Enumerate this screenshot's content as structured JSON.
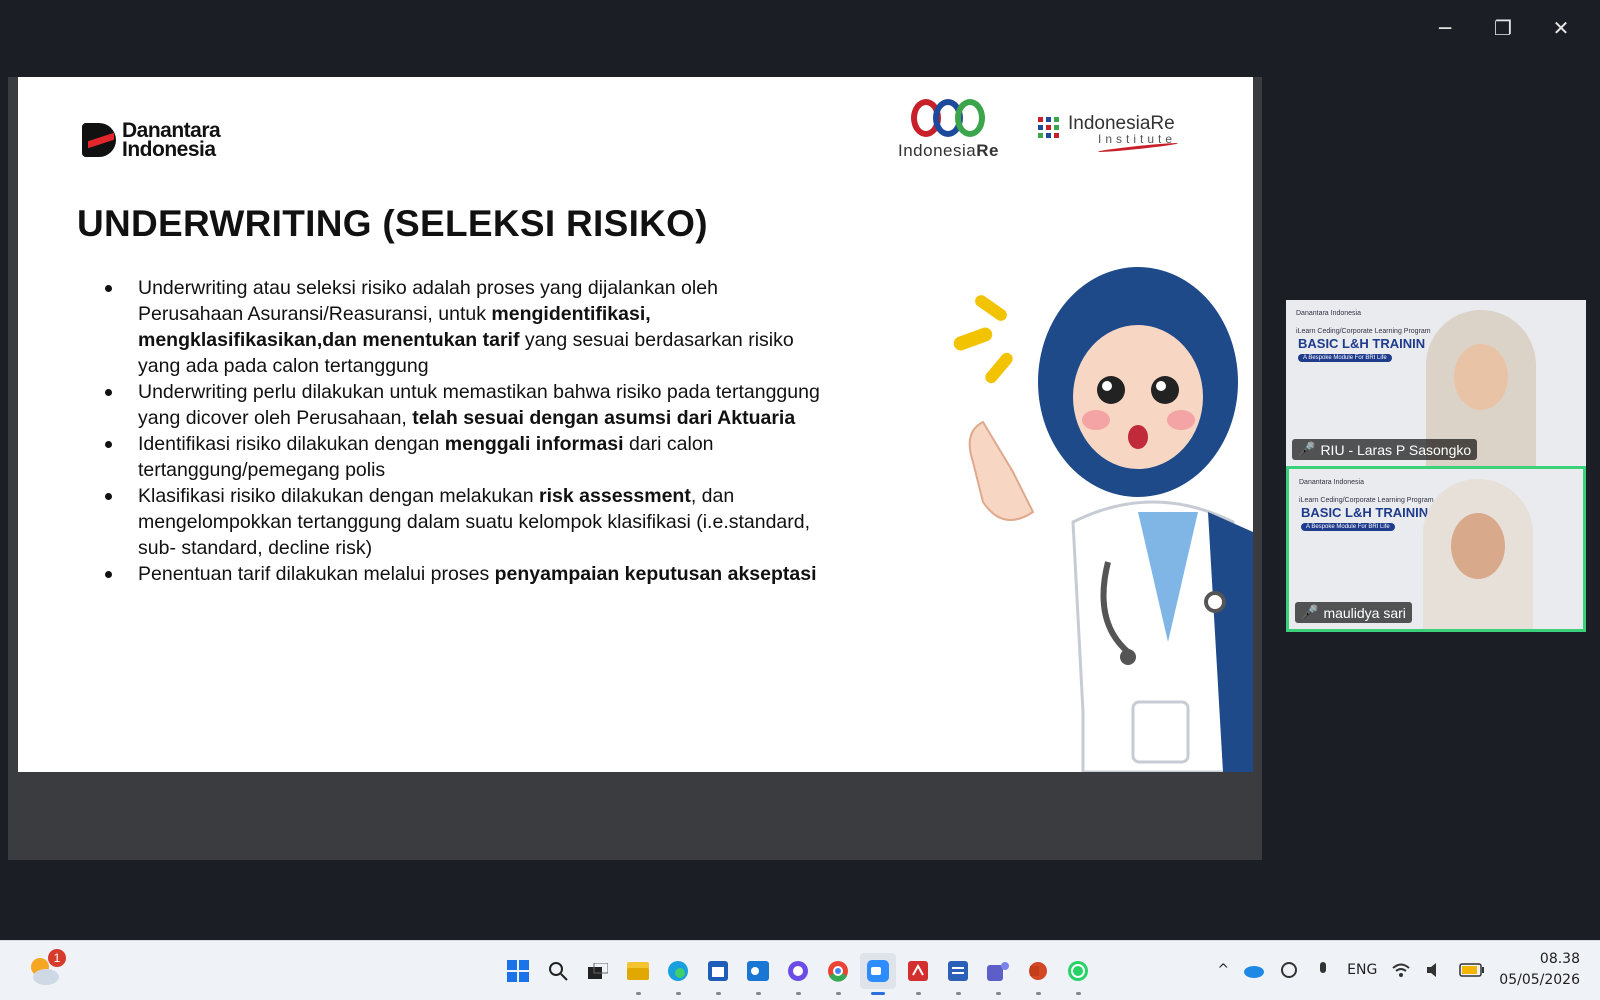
{
  "window": {
    "minimize": "─",
    "restore": "❐",
    "close": "✕"
  },
  "slide": {
    "logo_left_line1": "Danantara",
    "logo_left_line2": "Indonesia",
    "logo_ire_prefix": "Indonesia",
    "logo_ire_suffix": "Re",
    "logo_inst_title": "IndonesiaRe",
    "logo_inst_sub": "Institute",
    "title": "UNDERWRITING (SELEKSI RISIKO)",
    "bullets": [
      {
        "pre": "Underwriting atau seleksi risiko adalah proses yang dijalankan oleh Perusahaan Asuransi/Reasuransi, untuk ",
        "bold": "mengidentifikasi, mengklasifikasikan,dan menentukan tarif",
        "post": " yang sesuai berdasarkan risiko yang ada pada calon tertanggung"
      },
      {
        "pre": "Underwriting perlu dilakukan untuk memastikan bahwa risiko pada tertanggung yang dicover oleh Perusahaan, ",
        "bold": "telah sesuai dengan asumsi dari Aktuaria",
        "post": ""
      },
      {
        "pre": "Identifikasi risiko dilakukan dengan ",
        "bold": "menggali informasi",
        "post": " dari calon tertanggung/pemegang polis"
      },
      {
        "pre": "Klasifikasi risiko dilakukan dengan melakukan ",
        "bold": "risk assessment",
        "post": ", dan mengelompokkan tertanggung dalam suatu kelompok klasifikasi (i.e.standard, sub- standard, decline risk)"
      },
      {
        "pre": "Penentuan tarif dilakukan melalui proses ",
        "bold": "penyampaian keputusan akseptasi",
        "post": ""
      }
    ]
  },
  "gallery": {
    "tile_brand": "Danantara Indonesia",
    "tile_program": "iLearn Ceding/Corporate Learning Program",
    "tile_heading_1": "BASIC L&H TRAININ",
    "tile_heading_2": "BASIC L&H TRAINING",
    "tile_module": "A Bespoke Module For BRI Life",
    "participant_1": "RIU - Laras P Sasongko",
    "participant_2": "maulidya sari"
  },
  "taskbar": {
    "weather_badge": "1",
    "apps": [
      "windows-start",
      "search",
      "task-view",
      "file-explorer",
      "edge",
      "store",
      "outlook",
      "copilot",
      "chrome",
      "zoom",
      "acrobat",
      "word",
      "teams",
      "powerpoint",
      "whatsapp"
    ],
    "language": "ENG",
    "time": "08.38",
    "date": "05/05/2026"
  }
}
